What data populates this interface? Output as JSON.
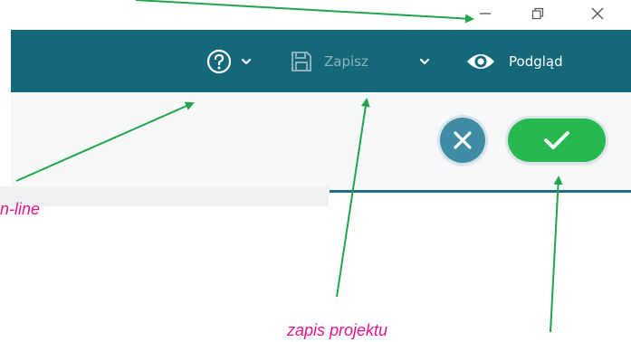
{
  "window_controls": {
    "minimize_icon": "minimize-icon",
    "restore_icon": "restore-icon",
    "close_icon": "close-icon"
  },
  "toolbar": {
    "background": "#146879",
    "help_icon": "help-circle-icon",
    "help_dropdown_icon": "chevron-down-icon",
    "save_icon": "floppy-disk-icon",
    "save_label": "Zapisz",
    "save_state": "disabled",
    "save_dropdown_icon": "chevron-down-icon",
    "preview_icon": "eye-icon",
    "preview_label": "Podgląd"
  },
  "actions": {
    "cancel_icon": "close-icon",
    "cancel_color": "#3f8da5",
    "confirm_icon": "checkmark-icon",
    "confirm_color": "#25b94f"
  },
  "annotations": {
    "online_label": "n-line",
    "save_label": "zapis projektu",
    "label_color": "#e6148c",
    "arrow_color": "#1fa54a"
  }
}
